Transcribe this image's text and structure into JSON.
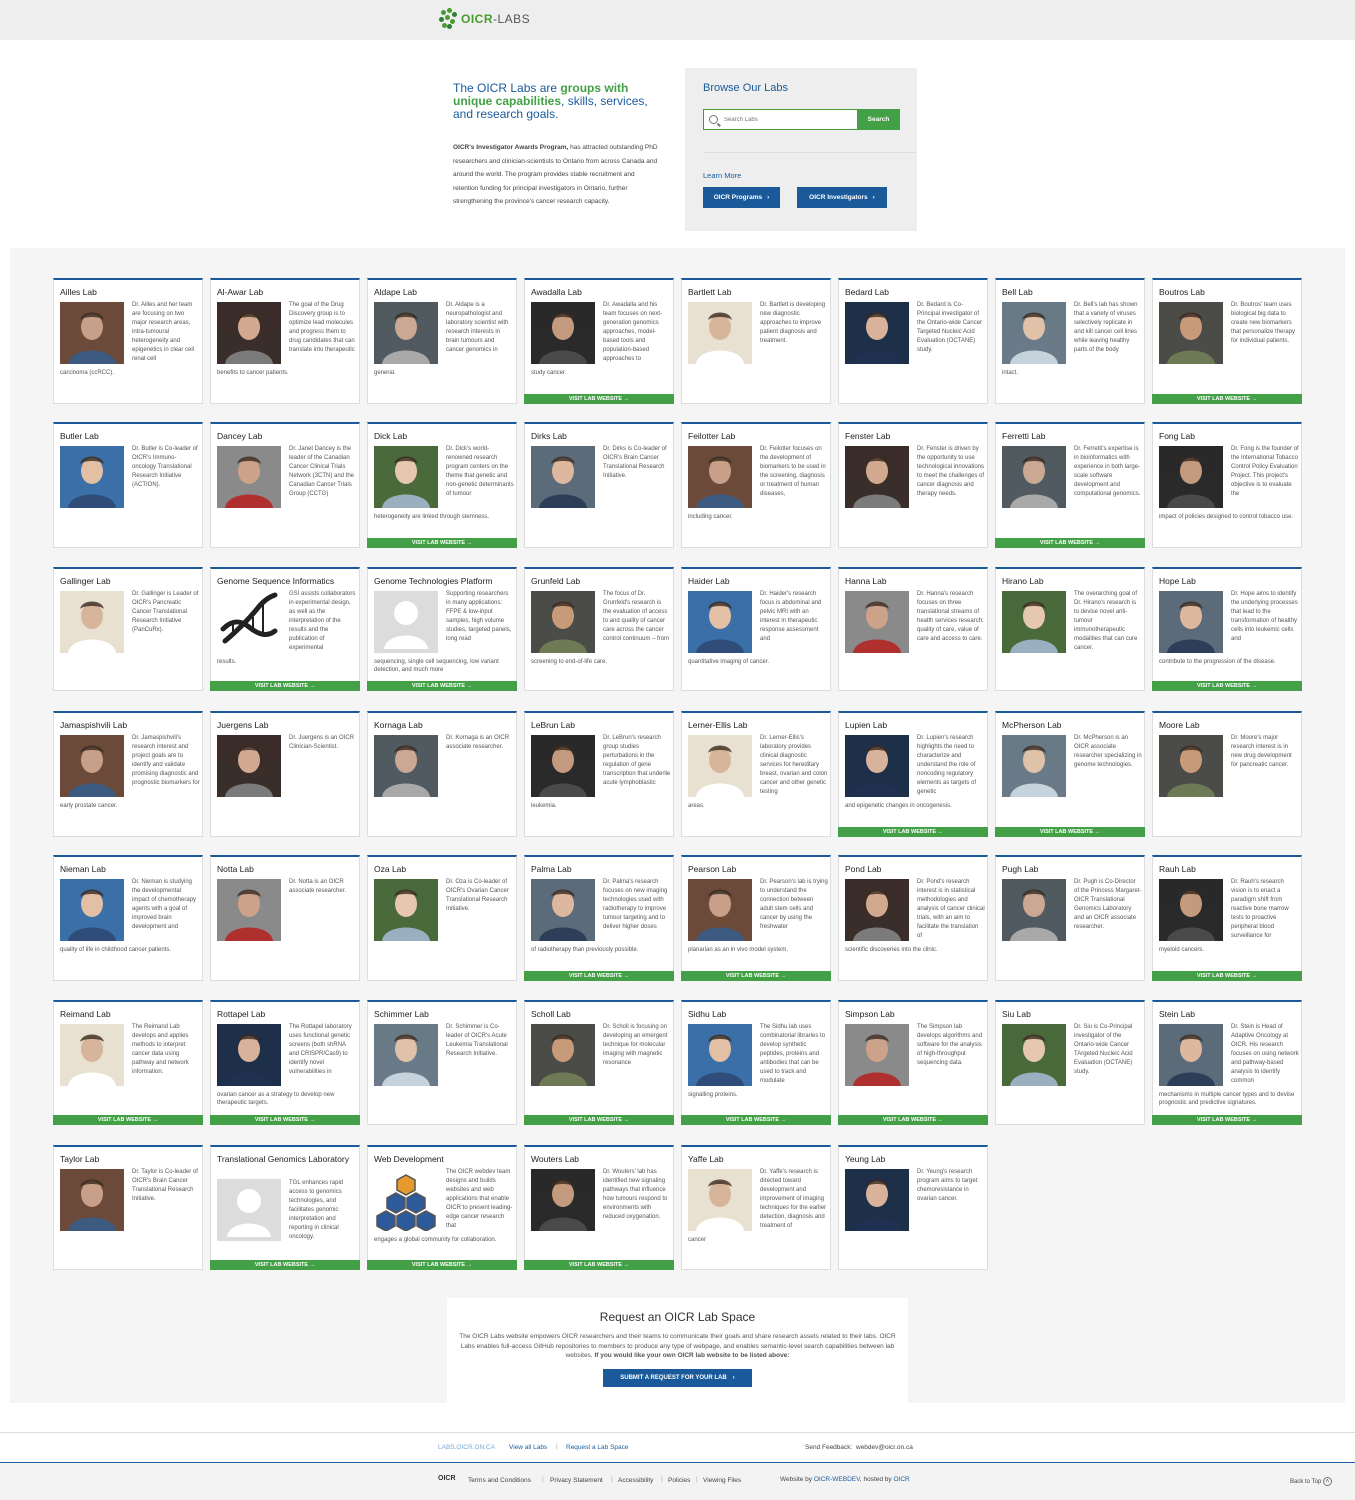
{
  "brand": {
    "name_a": "OICR",
    "name_b": "-LABS",
    "colors": {
      "blue": "#1a5a9b",
      "green": "#43a047"
    }
  },
  "hero": {
    "headline_plain_1": "The OICR Labs are ",
    "headline_bold": "groups with unique capabilities",
    "headline_plain_2": ", skills, services, and research goals.",
    "intro_bold": "OICR's Investigator Awards Program,",
    "intro_rest": " has attracted outstanding PhD researchers and clinician-scientists to Ontario from across Canada and around the world. The program provides stable recruitment and retention funding for principal investigators in Ontario, further strengthening the province's cancer research capacity."
  },
  "browse": {
    "title": "Browse Our Labs",
    "search_placeholder": "Search Labs",
    "search_button": "Search",
    "learn_more": "Learn More",
    "programs_button": "OICR Programs",
    "investigators_button": "OICR Investigators"
  },
  "visit_label": "VISIT LAB WEBSITE",
  "labs": [
    {
      "title": "Ailles Lab",
      "desc": "Dr. Ailles and her team are focusing on two major research areas, intra-tumoural heterogeneity and epigenetics in clear cell renal cell",
      "tail": "carcinoma (ccRCC).",
      "visit": false,
      "photo": "person"
    },
    {
      "title": "Al-Awar Lab",
      "desc": "The goal of the Drug Discovery group is to optimize lead molecules and progress them to drug candidates that can translate into therapeutic",
      "tail": "benefits to cancer patients.",
      "visit": false,
      "photo": "person"
    },
    {
      "title": "Aldape Lab",
      "desc": "Dr. Aldape is a neuropathologist and laboratory scientist with research interests in brain tumours and cancer genomics in",
      "tail": "general.",
      "visit": false,
      "photo": "person"
    },
    {
      "title": "Awadalla Lab",
      "desc": "Dr. Awadalla and his team focuses on next-generation genomics approaches, model-based tools and population-based approaches to",
      "tail": "study cancer.",
      "visit": true,
      "photo": "person"
    },
    {
      "title": "Bartlett Lab",
      "desc": "Dr. Bartlett is developing new diagnostic approaches to improve patient diagnosis and treatment.",
      "tail": "",
      "visit": false,
      "photo": "person"
    },
    {
      "title": "Bedard Lab",
      "desc": "Dr. Bedard is Co-Principal investigator of the Ontario-wide Cancer Targeted Nucleic Acid Evaluation (OCTANE) study.",
      "tail": "",
      "visit": false,
      "photo": "person"
    },
    {
      "title": "Bell Lab",
      "desc": "Dr. Bell's lab has shown that a variety of viruses selectively replicate in and kill cancer cell lines while leaving healthy parts of the body",
      "tail": "intact.",
      "visit": false,
      "photo": "person"
    },
    {
      "title": "Boutros Lab",
      "desc": "Dr. Boutros' team uses biological big data to create new biomarkers that personalize therapy for individual patients.",
      "tail": "",
      "visit": true,
      "photo": "person"
    },
    {
      "title": "Butler Lab",
      "desc": "Dr. Butler is Co-leader of OICR's Immuno-oncology Translational Research Initiative (ACTION).",
      "tail": "",
      "visit": false,
      "photo": "person"
    },
    {
      "title": "Dancey Lab",
      "desc": "Dr. Janet Dancey is the leader of the Canadian Cancer Clinical Trials Network (3CTN) and the Canadian Cancer Trials Group (CCTG)",
      "tail": "",
      "visit": false,
      "photo": "person"
    },
    {
      "title": "Dick Lab",
      "desc": "Dr. Dick's world-renowned research program centers on the theme that genetic and non-genetic determinants of tumour",
      "tail": "heterogeneity are linked through stemness.",
      "visit": true,
      "photo": "person"
    },
    {
      "title": "Dirks Lab",
      "desc": "Dr. Dirks is Co-leader of OICR's Brain Cancer Translational Research Initiative.",
      "tail": "",
      "visit": false,
      "photo": "person"
    },
    {
      "title": "Feilotter Lab",
      "desc": "Dr. Feilotter focuses on the development of biomarkers to be used in the screening, diagnosis or treatment of human diseases,",
      "tail": "including cancer.",
      "visit": false,
      "photo": "person"
    },
    {
      "title": "Fenster Lab",
      "desc": "Dr. Fenster is driven by the opportunity to use technological innovations to meet the challenges of cancer diagnosis and therapy needs.",
      "tail": "",
      "visit": false,
      "photo": "person"
    },
    {
      "title": "Ferretti Lab",
      "desc": "Dr. Ferretti's expertise is in bioinformatics with experience in both large-scale software development and computational genomics.",
      "tail": "",
      "visit": true,
      "photo": "person"
    },
    {
      "title": "Fong Lab",
      "desc": "Dr. Fong is the founder of the International Tobacco Control Policy Evaluation Project. This project's objective is to evaluate the",
      "tail": "impact of policies designed to control tobacco use.",
      "visit": false,
      "photo": "person"
    },
    {
      "title": "Gallinger Lab",
      "desc": "Dr. Gallinger is Leader of OICR's Pancreatic Cancer Translational Research Initiative (PanCuRx).",
      "tail": "",
      "visit": false,
      "photo": "person"
    },
    {
      "title": "Genome Sequence Informatics",
      "desc": "GSI assists collaborators in experimental design, as well as the interpretation of the results and the publication of experimental",
      "tail": "results.",
      "visit": true,
      "photo": "dna"
    },
    {
      "title": "Genome Technologies Platform",
      "desc": "Supporting researchers in many applications: FFPE & low-input samples, high volume studies, targeted panels, long read",
      "tail": "sequencing, single cell sequencing, low variant detection, and much more",
      "visit": true,
      "photo": "placeholder"
    },
    {
      "title": "Grunfeld Lab",
      "desc": "The focus of Dr. Grunfeld's research is the evaluation of access to and quality of cancer care across the cancer control continuum – from",
      "tail": "screening to end-of-life care.",
      "visit": false,
      "photo": "person"
    },
    {
      "title": "Haider Lab",
      "desc": "Dr. Haider's research focus is abdominal and pelvic MRI with an interest in therapeutic response assessment and",
      "tail": "quantitative imaging of cancer.",
      "visit": false,
      "photo": "person"
    },
    {
      "title": "Hanna Lab",
      "desc": "Dr. Hanna's research focuses on three translational streams of health services research: quality of care, value of care and access to care.",
      "tail": "",
      "visit": false,
      "photo": "person"
    },
    {
      "title": "Hirano Lab",
      "desc": "The overarching goal of Dr. Hirano's research is to devise novel anti-tumour immunotherapeutic modalities that can cure cancer.",
      "tail": "",
      "visit": false,
      "photo": "person"
    },
    {
      "title": "Hope Lab",
      "desc": "Dr. Hope aims to identify the underlying processes that lead to the transformation of healthy cells into leukemic cells and",
      "tail": "contribute to the progression of the disease.",
      "visit": true,
      "photo": "person"
    },
    {
      "title": "Jamaspishvili Lab",
      "desc": "Dr. Jamaspishvili's research interest and project goals are to identify and validate promising diagnostic and prognostic biomarkers for",
      "tail": "early prostate cancer.",
      "visit": false,
      "photo": "person"
    },
    {
      "title": "Juergens Lab",
      "desc": "Dr. Juergens is an OICR Clinician-Scientist.",
      "tail": "",
      "visit": false,
      "photo": "person"
    },
    {
      "title": "Kornaga Lab",
      "desc": "Dr. Kornaga is an OICR associate researcher.",
      "tail": "",
      "visit": false,
      "photo": "person"
    },
    {
      "title": "LeBrun Lab",
      "desc": "Dr. LeBrun's research group studies perturbations in the regulation of gene transcription that underlie acute lymphoblastic",
      "tail": "leukemia.",
      "visit": false,
      "photo": "person"
    },
    {
      "title": "Lerner-Ellis Lab",
      "desc": "Dr. Lerner-Ellis's laboratory provides clinical diagnostic services for hereditary breast, ovarian and colon cancer and other genetic testing",
      "tail": "areas.",
      "visit": false,
      "photo": "person"
    },
    {
      "title": "Lupien Lab",
      "desc": "Dr. Lupien's research highlights the need to characterize and understand the role of noncoding regulatory elements as targets of genetic",
      "tail": "and epigenetic changes in oncogenesis.",
      "visit": true,
      "photo": "person"
    },
    {
      "title": "McPherson Lab",
      "desc": "Dr. McPherson is an OICR associate researcher specializing in genome technologies.",
      "tail": "",
      "visit": true,
      "photo": "person"
    },
    {
      "title": "Moore Lab",
      "desc": "Dr. Moore's major research interest is in new drug development for pancreatic cancer.",
      "tail": "",
      "visit": false,
      "photo": "person"
    },
    {
      "title": "Nieman Lab",
      "desc": "Dr. Nieman is studying the developmental impact of chemotherapy agents with a goal of improved brain development and",
      "tail": "quality of life in childhood cancer patients.",
      "visit": false,
      "photo": "person"
    },
    {
      "title": "Notta Lab",
      "desc": "Dr. Notta is an OICR associate researcher.",
      "tail": "",
      "visit": false,
      "photo": "person"
    },
    {
      "title": "Oza Lab",
      "desc": "Dr. Oza is Co-leader of OICR's Ovarian Cancer Translational Research Initiative.",
      "tail": "",
      "visit": false,
      "photo": "person"
    },
    {
      "title": "Palma Lab",
      "desc": "Dr. Palma's research focuses on new imaging technologies used with radiotherapy to improve tumour targeting and to deliver higher doses",
      "tail": "of radiotherapy than previously possible.",
      "visit": true,
      "photo": "person"
    },
    {
      "title": "Pearson Lab",
      "desc": "Dr. Pearson's lab is trying to understand the connection between adult stem cells and cancer by using the freshwater",
      "tail": "planarian as an in vivo model system.",
      "visit": true,
      "photo": "person"
    },
    {
      "title": "Pond Lab",
      "desc": "Dr. Pond's research interest is in statistical methodologies and analysis of cancer clinical trials, with an aim to facilitate the translation of",
      "tail": "scientific discoveries into the clinic.",
      "visit": false,
      "photo": "person"
    },
    {
      "title": "Pugh Lab",
      "desc": "Dr. Pugh is Co-Director of the Princess Margaret-OICR Translational Genomics Laboratory and an OICR associate researcher.",
      "tail": "",
      "visit": false,
      "photo": "person"
    },
    {
      "title": "Rauh Lab",
      "desc": "Dr. Rauh's research vision is to enact a paradigm shift from reactive bone marrow tests to proactive peripheral blood surveillance for",
      "tail": "myeloid cancers.",
      "visit": true,
      "photo": "person"
    },
    {
      "title": "Reimand Lab",
      "desc": "The Reimand Lab develops and applies methods to interpret cancer data using pathway and network information.",
      "tail": "",
      "visit": true,
      "photo": "person"
    },
    {
      "title": "Rottapel Lab",
      "desc": "The Rottapel laboratory uses functional genetic screens (both shRNA and CRISPR/Cas9) to identify novel vulnerabilities in",
      "tail": "ovarian cancer as a strategy to develop new therapeutic targets.",
      "visit": true,
      "photo": "person"
    },
    {
      "title": "Schimmer Lab",
      "desc": "Dr. Schimmer is Co-leader of OICR's Acute Leukemia Translational Research Initiative.",
      "tail": "",
      "visit": false,
      "photo": "person"
    },
    {
      "title": "Scholl Lab",
      "desc": "Dr. Scholl is focusing on developing an emergent technique for molecular imaging with magnetic resonance",
      "tail": "",
      "visit": true,
      "photo": "person"
    },
    {
      "title": "Sidhu Lab",
      "desc": "The Sidhu lab uses combinatorial libraries to develop synthetic peptides, proteins and antibodies that can be used to track and modulate",
      "tail": "signalling proteins.",
      "visit": true,
      "photo": "person"
    },
    {
      "title": "Simpson Lab",
      "desc": "The Simpson lab develops algorithms and software for the analysis of high-throughput sequencing data.",
      "tail": "",
      "visit": true,
      "photo": "person"
    },
    {
      "title": "Siu Lab",
      "desc": "Dr. Siu is Co-Principal investigator of the Ontario-wide Cancer TArgeted Nucleic Acid Evaluation (OCTANE) study.",
      "tail": "",
      "visit": false,
      "photo": "person"
    },
    {
      "title": "Stein Lab",
      "desc": "Dr. Stein is Head of Adaptive Oncology at OICR. His research focuses on using network and pathway-based analysis to identify common",
      "tail": "mechanisms in multiple cancer types and to devise prognostic and predictive signatures.",
      "visit": true,
      "photo": "person"
    },
    {
      "title": "Taylor Lab",
      "desc": "Dr. Taylor is Co-leader of OICR's Brain Cancer Translational Research Initiative.",
      "tail": "",
      "visit": false,
      "photo": "person"
    },
    {
      "title": "Translational Genomics Laboratory",
      "desc": "TGL enhances rapid access to genomics technologies, and facilitates genomic interpretation and reporting in clinical oncology.",
      "tail": "",
      "visit": true,
      "photo": "placeholder"
    },
    {
      "title": "Web Development",
      "desc": "The OICR webdev team designs and builds websites and web applications that enable OICR to present leading-edge cancer research that",
      "tail": "engages a global community for collaboration.",
      "visit": true,
      "photo": "hex"
    },
    {
      "title": "Wouters Lab",
      "desc": "Dr. Wouters' lab has identified new signaling pathways that influence how tumours respond to environments with reduced oxygenation.",
      "tail": "",
      "visit": true,
      "photo": "person"
    },
    {
      "title": "Yaffe Lab",
      "desc": "Dr. Yaffe's research is directed toward development and improvement of imaging techniques for the earlier detection, diagnosis and treatment of",
      "tail": "cancer",
      "visit": false,
      "photo": "person"
    },
    {
      "title": "Yeung Lab",
      "desc": "Dr. Yeung's research program aims to target chemoresistance in ovarian cancer.",
      "tail": "",
      "visit": false,
      "photo": "person"
    }
  ],
  "request": {
    "title": "Request an OICR Lab Space",
    "text": "The OICR Labs website empowers OICR researchers and their teams to communicate their goals and share research assets related to their labs. OICR Labs enables full-access GitHub repositories to members to produce any type of webpage, and enables semantic-level search capabilities between lab websites.",
    "text_bold": "If you would like your own OICR lab website to be listed above:",
    "button": "SUBMIT A REQUEST FOR YOUR LAB"
  },
  "footer": {
    "site": "LABS.OICR.ON.CA",
    "view_all": "View all Labs",
    "request": "Request a Lab Space",
    "feedback_label": "Send Feedback:",
    "feedback_email": "webdev@oicr.on.ca",
    "logo": "OICR",
    "links": [
      "Terms and Conditions",
      "Privacy Statement",
      "Accessibility",
      "Policies",
      "Viewing Files"
    ],
    "website_by": "Website by",
    "webdev": "OICR-WEBDEV",
    "hosted_by": ", hosted by",
    "host": "OICR",
    "back_to_top": "Back to Top"
  }
}
